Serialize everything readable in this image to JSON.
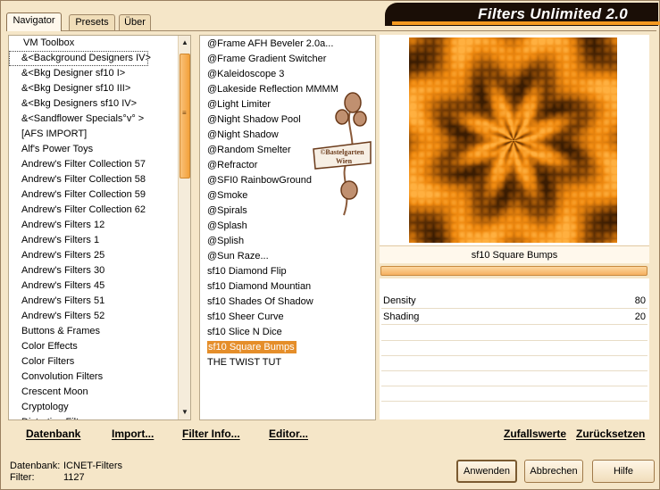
{
  "window": {
    "title": "Filters Unlimited 2.0"
  },
  "tabs": [
    {
      "label": "Navigator",
      "active": true
    },
    {
      "label": "Presets",
      "active": false
    },
    {
      "label": "Über",
      "active": false
    }
  ],
  "categories": {
    "selected_index": 1,
    "items": [
      "VM Toolbox",
      "&<Background Designers IV>",
      "&<Bkg Designer sf10 I>",
      "&<Bkg Designer sf10 III>",
      "&<Bkg Designers sf10 IV>",
      "&<Sandflower Specials°v° >",
      "[AFS IMPORT]",
      "Alf's Power Toys",
      "Andrew's Filter Collection 57",
      "Andrew's Filter Collection 58",
      "Andrew's Filter Collection 59",
      "Andrew's Filter Collection 62",
      "Andrew's Filters 12",
      "Andrew's Filters 1",
      "Andrew's Filters 25",
      "Andrew's Filters 30",
      "Andrew's Filters 45",
      "Andrew's Filters 51",
      "Andrew's Filters 52",
      "Buttons & Frames",
      "Color Effects",
      "Color Filters",
      "Convolution Filters",
      "Crescent Moon",
      "Cryptology",
      "Distortion Filters"
    ]
  },
  "filters": {
    "selected_index": 20,
    "items": [
      "@Frame AFH Beveler 2.0a...",
      "@Frame Gradient Switcher",
      "@Kaleidoscope 3",
      "@Lakeside Reflection MMMM",
      "@Light Limiter",
      "@Night Shadow Pool",
      "@Night Shadow",
      "@Random Smelter",
      "@Refractor",
      "@SFI0 RainbowGround",
      "@Smoke",
      "@Spirals",
      "@Splash",
      "@Splish",
      "@Sun Raze...",
      "sf10 Diamond Flip",
      "sf10 Diamond Mountian",
      "sf10 Shades Of Shadow",
      "sf10 Sheer Curve",
      "sf10 Slice N Dice",
      "sf10 Square Bumps",
      "THE TWIST TUT"
    ]
  },
  "watermark": {
    "text_line1": "©Bastelgarten",
    "text_line2": "Wien"
  },
  "preview": {
    "palette": [
      "#3a1c02",
      "#7a3f05",
      "#c06a0a",
      "#f08a10",
      "#ffb040"
    ],
    "style": "kaleidoscope-square-bumps"
  },
  "filter_name": "sf10 Square Bumps",
  "params": [
    {
      "label": "Density",
      "value": "80"
    },
    {
      "label": "Shading",
      "value": "20"
    }
  ],
  "left_toolbar": {
    "database": "Datenbank",
    "import": "Import...",
    "filter_info": "Filter Info...",
    "editor": "Editor..."
  },
  "right_toolbar": {
    "random": "Zufallswerte",
    "reset": "Zurücksetzen"
  },
  "status": {
    "db_label": "Datenbank:",
    "db_value": "ICNET-Filters",
    "filter_label": "Filter:",
    "filter_value": "1127"
  },
  "buttons": {
    "apply": "Anwenden",
    "cancel": "Abbrechen",
    "help": "Hilfe"
  },
  "colors": {
    "accent": "#e58e2a",
    "title_bg": "#1a0e06",
    "window_bg": "#f5e6c8"
  }
}
